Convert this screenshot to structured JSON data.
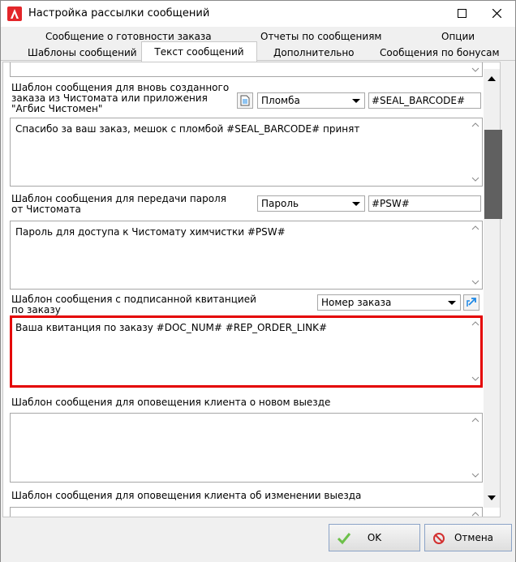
{
  "window": {
    "title": "Настройка рассылки сообщений",
    "minimize_symbol": "—",
    "maximize_symbol": "☐",
    "close_symbol": "✕"
  },
  "tabs": {
    "top_row": [
      "Сообщение о готовности заказа",
      "Отчеты по сообщениям",
      "Опции"
    ],
    "bottom_row": [
      "Шаблоны сообщений",
      "Текст сообщений",
      "Дополнительно",
      "Сообщения по бонусам"
    ],
    "active": "Текст сообщений"
  },
  "sections": {
    "new_order": {
      "label": "Шаблон сообщения для вновь созданного заказа из Чистомата или приложения \"Агбис Чистомен\"",
      "combo_value": "Пломба",
      "field_value": "#SEAL_BARCODE#",
      "memo_text": "Спасибо за ваш заказ, мешок с пломбой #SEAL_BARCODE# принят"
    },
    "password": {
      "label": "Шаблон сообщения для передачи пароля от Чистомата",
      "combo_value": "Пароль",
      "field_value": "#PSW#",
      "memo_text": "Пароль для доступа к Чистомату химчистки #PSW#"
    },
    "receipt": {
      "label": "Шаблон сообщения с подписанной квитанцией по заказу",
      "combo_value": "Номер заказа",
      "memo_text": "Ваша квитанция по заказу #DOC_NUM# #REP_ORDER_LINK#"
    },
    "new_visit": {
      "label": "Шаблон сообщения для оповещения клиента о новом выезде",
      "memo_text": ""
    },
    "visit_change": {
      "label": "Шаблон сообщения для оповещения клиента об изменении выезда",
      "memo_text": ""
    }
  },
  "footer": {
    "ok_label": "OK",
    "cancel_label": "Отмена"
  },
  "colors": {
    "highlight": "#e40000",
    "ok_check": "#4caf50",
    "cancel_icon": "#d32f2f",
    "insert_icon": "#1e88e5"
  }
}
